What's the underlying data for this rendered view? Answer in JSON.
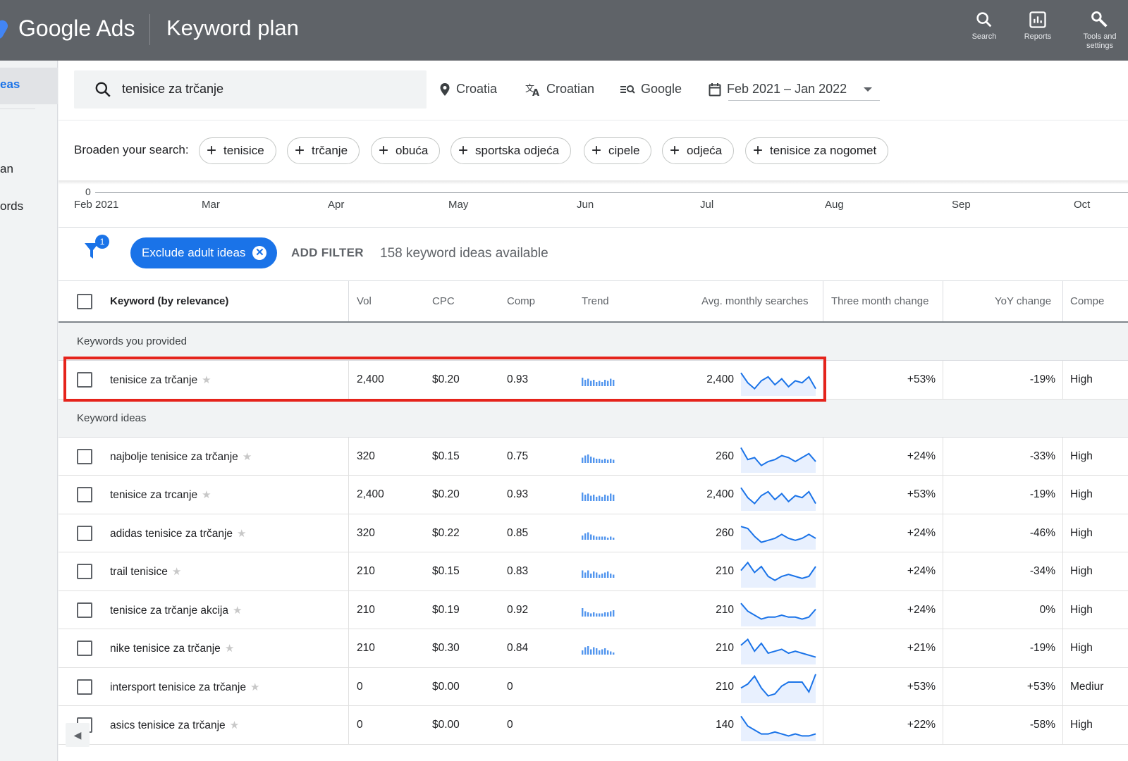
{
  "header": {
    "brand": "Google Ads",
    "page_title": "Keyword plan",
    "nav": [
      {
        "label": "Search",
        "icon": "search-icon"
      },
      {
        "label": "Reports",
        "icon": "reports-icon"
      },
      {
        "label": "Tools and settings",
        "icon": "wrench-icon"
      }
    ]
  },
  "left_nav": {
    "items": [
      "eas",
      "an",
      "ords"
    ]
  },
  "search": {
    "query": "tenisice za trčanje",
    "location": "Croatia",
    "language": "Croatian",
    "network": "Google",
    "date_range": "Feb 2021 – Jan 2022"
  },
  "broaden": {
    "label": "Broaden your search:",
    "chips": [
      "tenisice",
      "trčanje",
      "obuća",
      "sportska odjeća",
      "cipele",
      "odjeća",
      "tenisice za nogomet"
    ]
  },
  "timeline": {
    "zero": "0",
    "months": [
      "Feb 2021",
      "Mar",
      "Apr",
      "May",
      "Jun",
      "Jul",
      "Aug",
      "Sep",
      "Oct"
    ]
  },
  "filter": {
    "badge": "1",
    "exclude_label": "Exclude adult ideas",
    "add_filter": "ADD FILTER",
    "count_text": "158 keyword ideas available"
  },
  "table": {
    "columns": [
      "Keyword (by relevance)",
      "Vol",
      "CPC",
      "Comp",
      "Trend",
      "Avg. monthly searches",
      "Three month change",
      "YoY change",
      "Compe"
    ],
    "group_provided": "Keywords you provided",
    "group_ideas": "Keyword ideas",
    "provided_rows": [
      {
        "keyword": "tenisice za trčanje",
        "vol": "2,400",
        "cpc": "$0.20",
        "comp": "0.93",
        "trend_bars": [
          8,
          6,
          7,
          5,
          6,
          4,
          5,
          4,
          6,
          5,
          7,
          6
        ],
        "avg": "2,400",
        "spark": [
          22,
          12,
          6,
          14,
          18,
          10,
          16,
          8,
          14,
          12,
          18,
          6
        ],
        "three_month": "+53%",
        "yoy": "-19%",
        "competition": "High"
      }
    ],
    "idea_rows": [
      {
        "keyword": "najbolje tenisice za trčanje",
        "vol": "320",
        "cpc": "$0.15",
        "comp": "0.75",
        "trend_bars": [
          5,
          7,
          8,
          6,
          5,
          4,
          4,
          3,
          4,
          3,
          4,
          3
        ],
        "avg": "260",
        "spark": [
          24,
          12,
          14,
          6,
          10,
          12,
          16,
          14,
          10,
          14,
          18,
          10
        ],
        "three_month": "+24%",
        "yoy": "-33%",
        "competition": "High"
      },
      {
        "keyword": "tenisice za trcanje",
        "vol": "2,400",
        "cpc": "$0.20",
        "comp": "0.93",
        "trend_bars": [
          8,
          6,
          7,
          5,
          6,
          4,
          5,
          4,
          6,
          5,
          7,
          6
        ],
        "avg": "2,400",
        "spark": [
          22,
          12,
          6,
          14,
          18,
          10,
          16,
          8,
          14,
          12,
          18,
          6
        ],
        "three_month": "+53%",
        "yoy": "-19%",
        "competition": "High"
      },
      {
        "keyword": "adidas tenisice za trčanje",
        "vol": "320",
        "cpc": "$0.22",
        "comp": "0.85",
        "trend_bars": [
          4,
          6,
          7,
          5,
          4,
          3,
          3,
          3,
          3,
          2,
          3,
          2
        ],
        "avg": "260",
        "spark": [
          22,
          20,
          12,
          6,
          8,
          10,
          14,
          10,
          8,
          10,
          14,
          10
        ],
        "three_month": "+24%",
        "yoy": "-46%",
        "competition": "High"
      },
      {
        "keyword": "trail tenisice",
        "vol": "210",
        "cpc": "$0.15",
        "comp": "0.83",
        "trend_bars": [
          7,
          5,
          7,
          4,
          6,
          5,
          3,
          4,
          5,
          6,
          4,
          3
        ],
        "avg": "210",
        "spark": [
          16,
          24,
          14,
          20,
          10,
          6,
          10,
          12,
          10,
          8,
          10,
          20
        ],
        "three_month": "+24%",
        "yoy": "-34%",
        "competition": "High"
      },
      {
        "keyword": "tenisice za trčanje akcija",
        "vol": "210",
        "cpc": "$0.19",
        "comp": "0.92",
        "trend_bars": [
          8,
          5,
          4,
          3,
          4,
          3,
          3,
          3,
          4,
          4,
          5,
          6
        ],
        "avg": "210",
        "spark": [
          22,
          14,
          10,
          6,
          8,
          8,
          10,
          8,
          8,
          6,
          8,
          16
        ],
        "three_month": "+24%",
        "yoy": "0%",
        "competition": "High"
      },
      {
        "keyword": "nike tenisice za trčanje",
        "vol": "210",
        "cpc": "$0.30",
        "comp": "0.84",
        "trend_bars": [
          4,
          7,
          8,
          5,
          7,
          6,
          4,
          5,
          6,
          4,
          3,
          2
        ],
        "avg": "210",
        "spark": [
          18,
          24,
          12,
          20,
          10,
          12,
          14,
          10,
          12,
          10,
          8,
          6
        ],
        "three_month": "+21%",
        "yoy": "-19%",
        "competition": "High"
      },
      {
        "keyword": "intersport tenisice za trčanje",
        "vol": "0",
        "cpc": "$0.00",
        "comp": "0",
        "trend_bars": [],
        "avg": "210",
        "spark": [
          14,
          18,
          26,
          14,
          6,
          8,
          16,
          20,
          20,
          20,
          10,
          28
        ],
        "three_month": "+53%",
        "yoy": "+53%",
        "competition": "Mediur"
      },
      {
        "keyword": "asics tenisice za trčanje",
        "vol": "0",
        "cpc": "$0.00",
        "comp": "0",
        "trend_bars": [],
        "avg": "140",
        "spark": [
          24,
          14,
          10,
          6,
          6,
          8,
          6,
          4,
          6,
          4,
          4,
          6
        ],
        "three_month": "+22%",
        "yoy": "-58%",
        "competition": "High"
      }
    ]
  },
  "colors": {
    "topbar": "#5f6368",
    "accent": "#1a73e8",
    "highlight_border": "#e5231b",
    "spark_line": "#1a73e8",
    "spark_fill": "#e8f0fe"
  }
}
